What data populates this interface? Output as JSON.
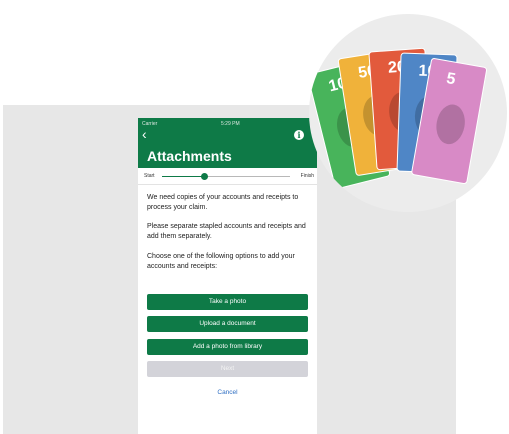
{
  "status_bar": {
    "carrier": "Carrier",
    "time": "5:29 PM"
  },
  "header": {
    "back_icon": "chevron-left-icon",
    "info_icon": "info-icon",
    "title": "Attachments",
    "color": "#0e7a47"
  },
  "progress": {
    "start_label": "Start",
    "finish_label": "Finish",
    "fraction": 0.33
  },
  "content": {
    "paragraph_1": "We need copies of your accounts and receipts to process your claim.",
    "paragraph_2": "Please separate stapled accounts and receipts and add them separately.",
    "paragraph_3": "Choose one of the following options to add your accounts and receipts:"
  },
  "buttons": {
    "take_photo": "Take a photo",
    "upload_document": "Upload a document",
    "add_from_library": "Add a photo from library",
    "next": "Next",
    "cancel": "Cancel"
  },
  "banknotes": [
    {
      "denomination": "100",
      "color": "#48b45b"
    },
    {
      "denomination": "50",
      "color": "#f0b23a"
    },
    {
      "denomination": "20",
      "color": "#e25a3c"
    },
    {
      "denomination": "10",
      "color": "#4f86c6"
    },
    {
      "denomination": "5",
      "color": "#d88ac6"
    }
  ]
}
